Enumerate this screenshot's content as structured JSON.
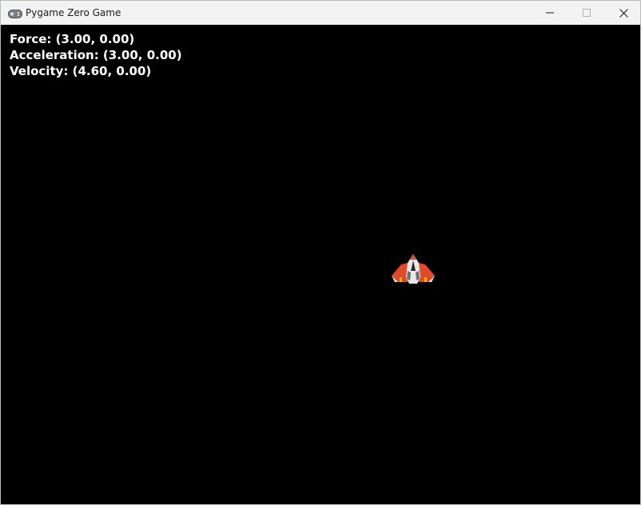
{
  "window": {
    "title": "Pygame Zero Game",
    "icons": {
      "app": "gamepad-icon",
      "minimize": "minimize-icon",
      "maximize": "maximize-icon",
      "close": "close-icon"
    }
  },
  "hud": {
    "force": "Force: (3.00, 0.00)",
    "acceleration": "Acceleration: (3.00, 0.00)",
    "velocity": "Velocity: (4.60, 0.00)"
  },
  "sprites": {
    "player": "spaceship-icon"
  },
  "colors": {
    "background": "#000000",
    "hud_text": "#ffffff",
    "titlebar": "#f3f3f3",
    "ship_red": "#e04a2c",
    "ship_white": "#e8e8e8",
    "ship_flame": "#f5b400"
  }
}
